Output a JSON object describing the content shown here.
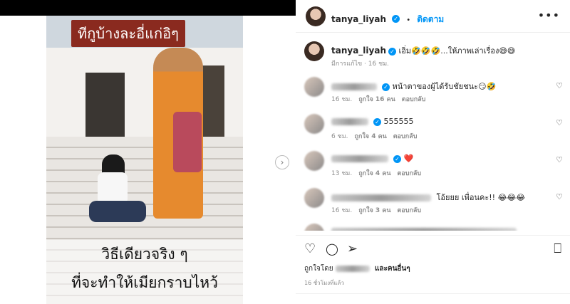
{
  "post": {
    "username": "tanya_liyah",
    "follow_label": "ติดตาม",
    "more_label": "•••",
    "caption_text": "เอิ่ม🤣🤣🤣...ให้ภาพเล่าเรื่อง😅😅",
    "caption_edited": "มีการแก้ไข · 16 ชม."
  },
  "image": {
    "overlay_top": "ทีกูบ้างละอี่แก่อิๆ",
    "overlay_bottom_line1": "วิธีเดียวจริง ๆ",
    "overlay_bottom_line2": "ที่จะทำให้เมียกราบไหว้",
    "next_glyph": "›"
  },
  "comments": [
    {
      "text": "หน้าตาของผู้ได้รับชัยชนะ😏🤣",
      "time": "16 ชม.",
      "likes": "ถูกใจ 16 คน",
      "reply": "ตอบกลับ"
    },
    {
      "text": "555555",
      "time": "6 ชม.",
      "likes": "ถูกใจ 4 คน",
      "reply": "ตอบกลับ"
    },
    {
      "text": "❤️",
      "time": "13 ชม.",
      "likes": "ถูกใจ 4 คน",
      "reply": "ตอบกลับ"
    },
    {
      "text": "โอ้ยยย เพื่อนคะ!! 😂😂😂",
      "time": "16 ชม.",
      "likes": "ถูกใจ 3 คน",
      "reply": "ตอบกลับ"
    }
  ],
  "actions": {
    "like_icon": "♡",
    "comment_icon": "◯",
    "share_icon": "➢",
    "save_icon": "⎕"
  },
  "likes_line": {
    "prefix": "ถูกใจโดย",
    "suffix": "และคนอื่นๆ"
  },
  "timestamp": "16 ชั่วโมงที่แล้ว",
  "colors": {
    "accent": "#0095f6",
    "heart_red": "#ed4956",
    "muted": "#8e8e8e"
  }
}
